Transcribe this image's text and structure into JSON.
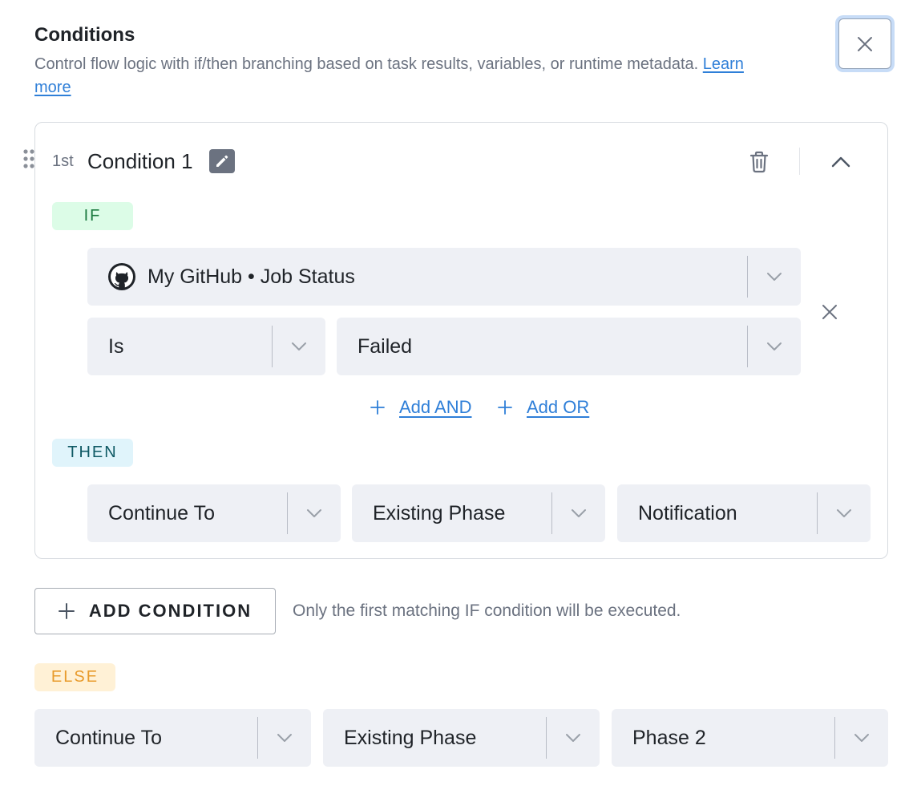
{
  "header": {
    "title": "Conditions",
    "description": "Control flow logic with if/then branching based on task results, variables, or runtime metadata.",
    "learn_more": "Learn more"
  },
  "condition": {
    "ordinal": "1st",
    "title": "Condition 1",
    "if_label": "IF",
    "source": "My GitHub • Job Status",
    "operator": "Is",
    "value": "Failed",
    "add_and": "Add AND",
    "add_or": "Add OR",
    "then_label": "THEN",
    "then_action": "Continue To",
    "then_target_type": "Existing Phase",
    "then_target": "Notification"
  },
  "footer": {
    "add_condition": "ADD CONDITION",
    "hint": "Only the first matching IF condition will be executed."
  },
  "else_block": {
    "label": "ELSE",
    "action": "Continue To",
    "target_type": "Existing Phase",
    "target": "Phase 2"
  },
  "icons": {
    "close": "close-icon",
    "drag": "drag-handle-icon",
    "edit": "pencil-icon",
    "delete": "trash-icon",
    "collapse": "chevron-up-icon",
    "dropdown": "chevron-down-icon",
    "source": "github-icon",
    "add": "plus-icon"
  },
  "colors": {
    "link": "#2f7fd8",
    "if_badge_bg": "#dcfce7",
    "then_badge_bg": "#e0f4fb",
    "else_badge_bg": "#fff1d6",
    "select_bg": "#eef0f5"
  }
}
